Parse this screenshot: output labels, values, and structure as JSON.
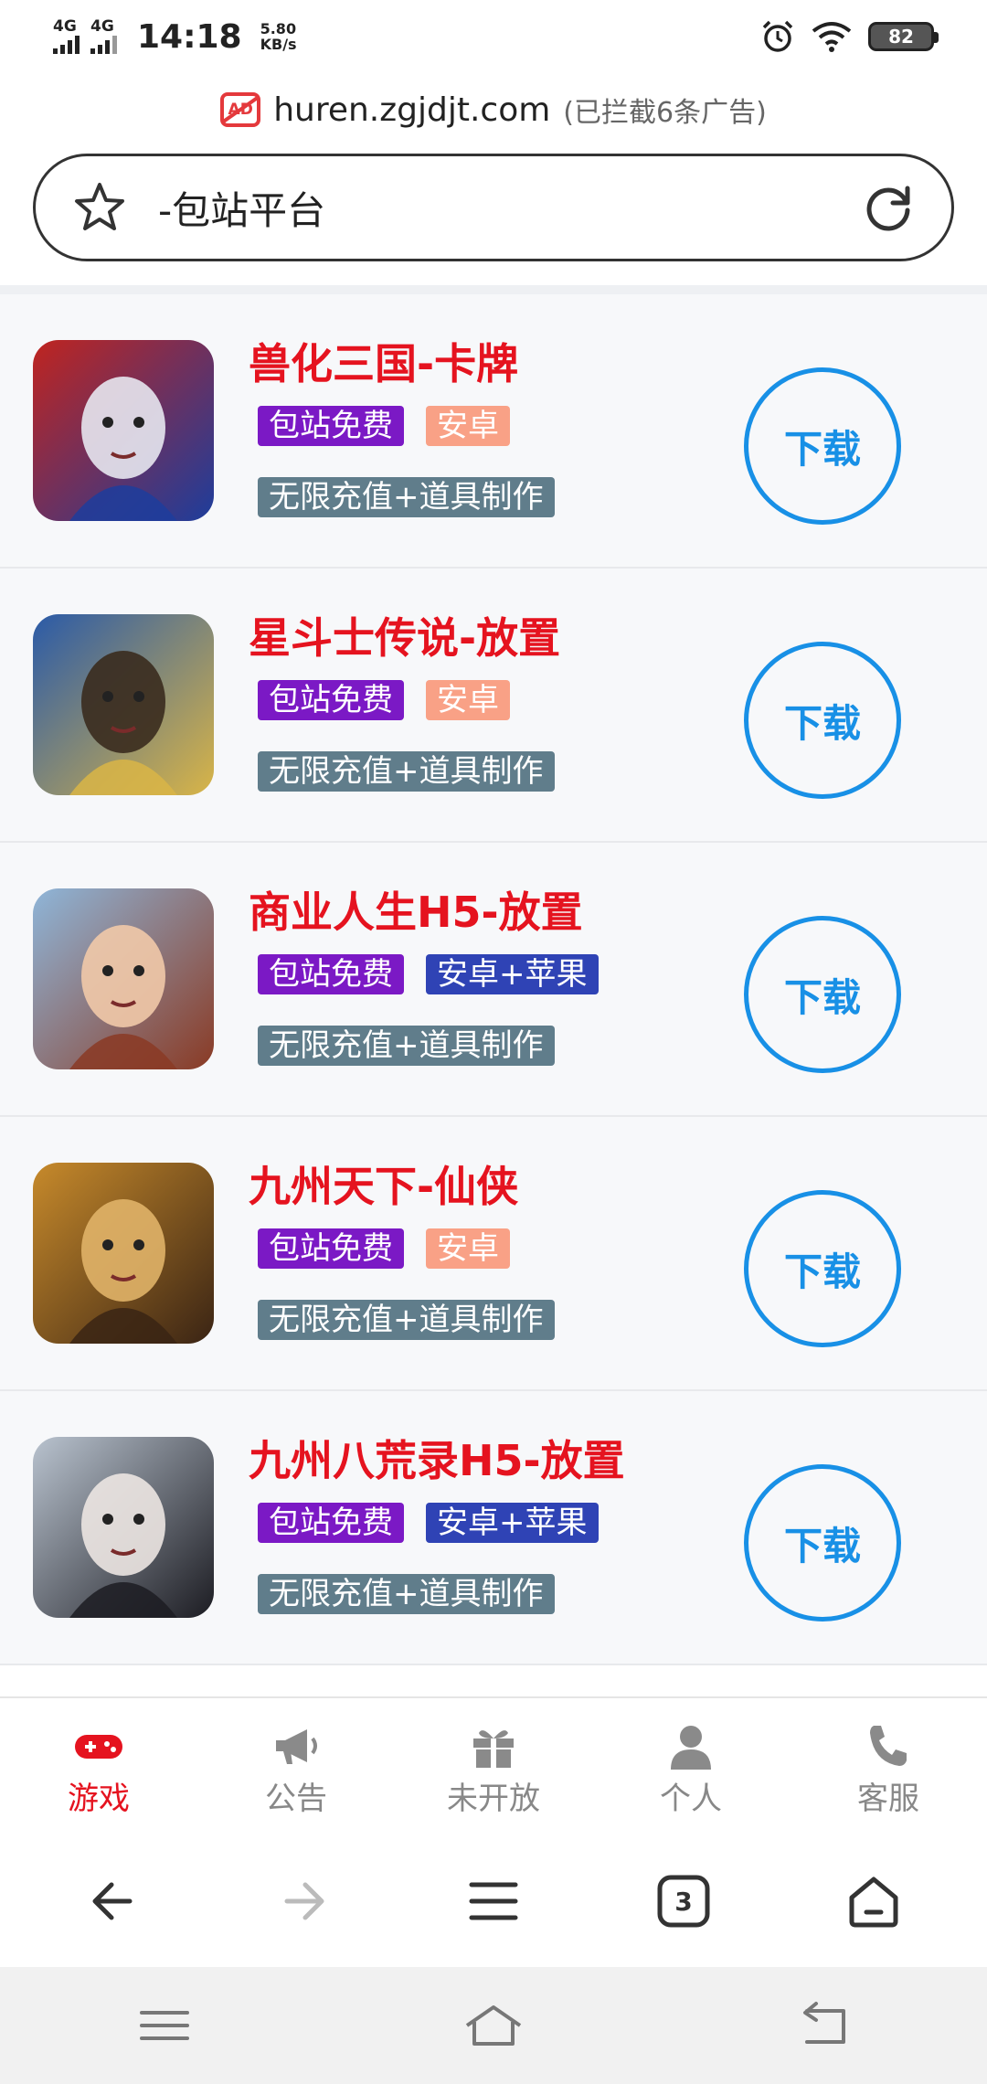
{
  "status_bar": {
    "net1": "4G",
    "net2": "4G",
    "time": "14:18",
    "speed_value": "5.80",
    "speed_unit": "KB/s",
    "battery": "82"
  },
  "url_row": {
    "domain": "huren.zgjdjt.com",
    "ad_note": "(已拦截6条广告)",
    "ad_icon_text": "AD"
  },
  "search": {
    "text": "-包站平台"
  },
  "games": [
    {
      "title": "兽化三国-卡牌",
      "tags": [
        {
          "label": "包站免费",
          "style": "purple"
        },
        {
          "label": "安卓",
          "style": "orange"
        }
      ],
      "feature": "无限充值+道具制作",
      "download": "下载",
      "thumb_colors": [
        "#c0241f",
        "#1d3d9c",
        "#e7e7ef"
      ]
    },
    {
      "title": "星斗士传说-放置",
      "tags": [
        {
          "label": "包站免费",
          "style": "purple"
        },
        {
          "label": "安卓",
          "style": "orange"
        }
      ],
      "feature": "无限充值+道具制作",
      "download": "下载",
      "thumb_colors": [
        "#2a5aa8",
        "#d9b547",
        "#3a2b1e"
      ]
    },
    {
      "title": "商业人生H5-放置",
      "tags": [
        {
          "label": "包站免费",
          "style": "purple"
        },
        {
          "label": "安卓+苹果",
          "style": "blue"
        }
      ],
      "feature": "无限充值+道具制作",
      "download": "下载",
      "thumb_colors": [
        "#8fb6d9",
        "#8a3a24",
        "#f1c9a8"
      ]
    },
    {
      "title": "九州天下-仙侠",
      "tags": [
        {
          "label": "包站免费",
          "style": "purple"
        },
        {
          "label": "安卓",
          "style": "orange"
        }
      ],
      "feature": "无限充值+道具制作",
      "download": "下载",
      "thumb_colors": [
        "#c78a2b",
        "#3a2414",
        "#e0b268"
      ]
    },
    {
      "title": "九州八荒录H5-放置",
      "tags": [
        {
          "label": "包站免费",
          "style": "purple"
        },
        {
          "label": "安卓+苹果",
          "style": "blue"
        }
      ],
      "feature": "无限充值+道具制作",
      "download": "下载",
      "thumb_colors": [
        "#b9c3cf",
        "#1c1c22",
        "#ece6e2"
      ]
    }
  ],
  "tabs": [
    {
      "label": "游戏",
      "icon": "gamepad-icon",
      "active": true
    },
    {
      "label": "公告",
      "icon": "megaphone-icon",
      "active": false
    },
    {
      "label": "未开放",
      "icon": "gift-icon",
      "active": false
    },
    {
      "label": "个人",
      "icon": "person-icon",
      "active": false
    },
    {
      "label": "客服",
      "icon": "phone-icon",
      "active": false
    }
  ],
  "browser_nav": {
    "tab_count": "3"
  },
  "colors": {
    "accent_red": "#e5131f",
    "download_blue": "#1890e6",
    "tag_purple": "#7b19c5",
    "tag_orange": "#f9a186",
    "tag_blue": "#2f43b5",
    "tag_gray": "#607d8b"
  }
}
